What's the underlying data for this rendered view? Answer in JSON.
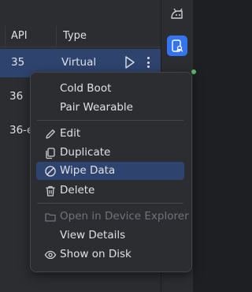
{
  "table": {
    "columns": {
      "api": "API",
      "type": "Type"
    },
    "rows": [
      {
        "api": "35",
        "type": "Virtual"
      },
      {
        "api": "36",
        "type": ""
      },
      {
        "api": "36-e",
        "type": ""
      }
    ]
  },
  "menu": {
    "items": [
      {
        "label": "Cold Boot"
      },
      {
        "label": "Pair Wearable"
      },
      {
        "label": "Edit"
      },
      {
        "label": "Duplicate"
      },
      {
        "label": "Wipe Data"
      },
      {
        "label": "Delete"
      },
      {
        "label": "Open in Device Explorer"
      },
      {
        "label": "View Details"
      },
      {
        "label": "Show on Disk"
      }
    ]
  },
  "icons": {
    "tool_strip": [
      "android-device-icon",
      "device-manager-icon"
    ],
    "row_actions": [
      "play-icon",
      "more-vertical-icon"
    ],
    "menu": [
      "pencil-icon",
      "duplicate-icon",
      "wipe-data-icon",
      "trash-icon",
      "folder-icon",
      "eye-icon"
    ]
  },
  "colors": {
    "accent": "#3574f0",
    "selection": "#2e436e",
    "status_green": "#5fb865"
  }
}
